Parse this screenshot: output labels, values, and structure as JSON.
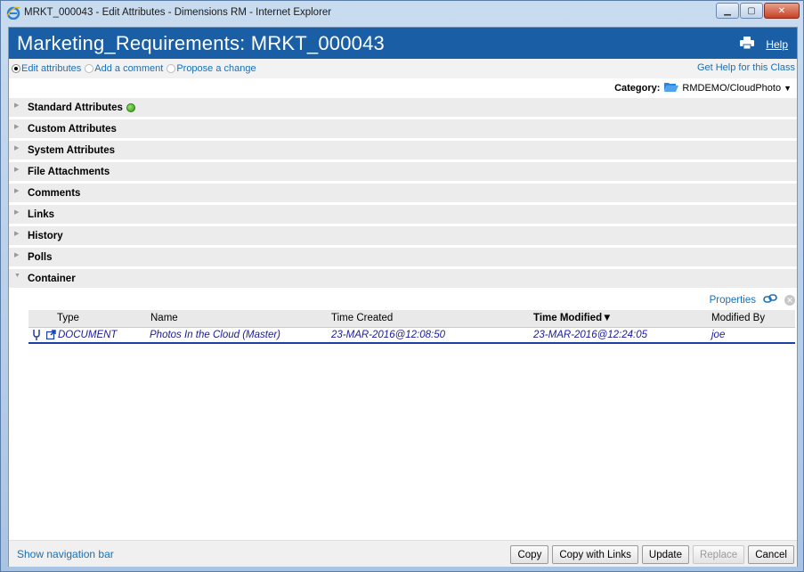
{
  "window": {
    "title": "MRKT_000043 - Edit Attributes - Dimensions RM - Internet Explorer"
  },
  "header": {
    "title": "Marketing_Requirements: MRKT_000043",
    "help": "Help"
  },
  "modes": {
    "edit": "Edit attributes",
    "comment": "Add a comment",
    "propose": "Propose a change",
    "help_class": "Get Help for this Class"
  },
  "category": {
    "label": "Category:",
    "value": "RMDEMO/CloudPhoto"
  },
  "sections": [
    {
      "title": "Standard Attributes"
    },
    {
      "title": "Custom Attributes"
    },
    {
      "title": "System Attributes"
    },
    {
      "title": "File Attachments"
    },
    {
      "title": "Comments"
    },
    {
      "title": "Links"
    },
    {
      "title": "History"
    },
    {
      "title": "Polls"
    },
    {
      "title": "Container"
    }
  ],
  "container": {
    "properties": "Properties",
    "columns": {
      "type": "Type",
      "name": "Name",
      "created": "Time Created",
      "modified": "Time Modified",
      "by": "Modified By"
    },
    "rows": [
      {
        "type": "DOCUMENT",
        "name": "Photos In the Cloud (Master)",
        "created": "23-MAR-2016@12:08:50",
        "modified": "23-MAR-2016@12:24:05",
        "by": "joe"
      }
    ]
  },
  "footer": {
    "nav": "Show navigation bar",
    "copy": "Copy",
    "copy_links": "Copy with Links",
    "update": "Update",
    "replace": "Replace",
    "cancel": "Cancel"
  },
  "colors": {
    "header_bg": "#1a5fa6",
    "link": "#1b6fb5",
    "row_text": "#1b1b9a"
  }
}
